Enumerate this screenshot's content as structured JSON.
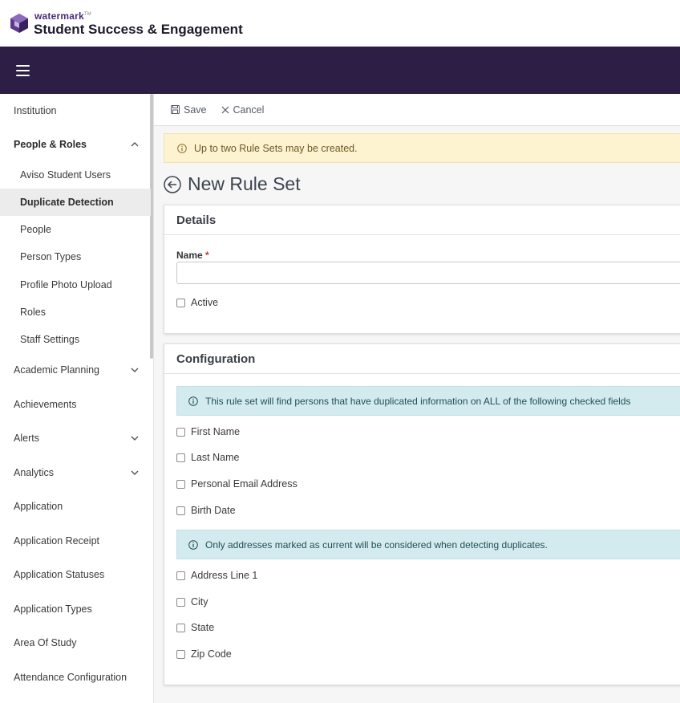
{
  "brand": {
    "company": "watermark",
    "tm": "TM",
    "product": "Student Success & Engagement"
  },
  "sidebar": {
    "items": [
      {
        "label": "Institution"
      },
      {
        "label": "People & Roles"
      },
      {
        "label": "Aviso Student Users"
      },
      {
        "label": "Duplicate Detection"
      },
      {
        "label": "People"
      },
      {
        "label": "Person Types"
      },
      {
        "label": "Profile Photo Upload"
      },
      {
        "label": "Roles"
      },
      {
        "label": "Staff Settings"
      },
      {
        "label": "Academic Planning"
      },
      {
        "label": "Achievements"
      },
      {
        "label": "Alerts"
      },
      {
        "label": "Analytics"
      },
      {
        "label": "Application"
      },
      {
        "label": "Application Receipt"
      },
      {
        "label": "Application Statuses"
      },
      {
        "label": "Application Types"
      },
      {
        "label": "Area Of Study"
      },
      {
        "label": "Attendance Configuration"
      }
    ]
  },
  "toolbar": {
    "save_label": "Save",
    "cancel_label": "Cancel"
  },
  "notice": {
    "text": "Up to two Rule Sets may be created."
  },
  "page": {
    "title": "New Rule Set"
  },
  "details": {
    "heading": "Details",
    "name_label": "Name",
    "required_mark": "*",
    "name_value": "",
    "active_label": "Active"
  },
  "configuration": {
    "heading": "Configuration",
    "info_text": "This rule set will find persons that have duplicated information on ALL of the following checked fields",
    "fields": [
      "First Name",
      "Last Name",
      "Personal Email Address",
      "Birth Date"
    ],
    "address_info_text": "Only addresses marked as current will be considered when detecting duplicates.",
    "address_fields": [
      "Address Line 1",
      "City",
      "State",
      "Zip Code"
    ]
  },
  "colors": {
    "navbar": "#2c1e44",
    "brand_purple": "#4b2a7a",
    "warning_bg": "#fdf3d1",
    "info_bg": "#d3ebee"
  }
}
